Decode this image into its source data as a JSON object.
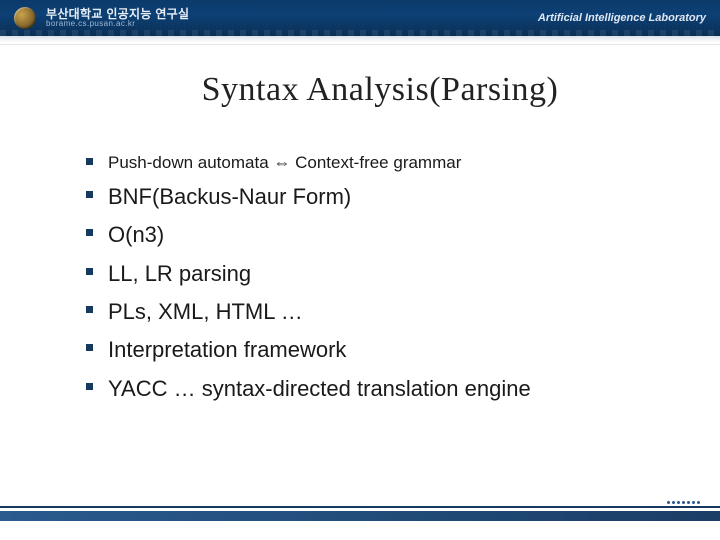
{
  "header": {
    "institution_ko": "부산대학교 인공지능 연구실",
    "institution_url": "borame.cs.pusan.ac.kr",
    "lab_name_en": "Artificial Intelligence Laboratory"
  },
  "slide": {
    "title": "Syntax Analysis(Parsing)",
    "bullets": [
      {
        "text": "Push-down automata ⇔ Context-free grammar",
        "size": "small"
      },
      {
        "text": "BNF(Backus-Naur Form)",
        "size": "large"
      },
      {
        "text": "O(n3)",
        "size": "large"
      },
      {
        "text": "LL, LR parsing",
        "size": "large"
      },
      {
        "text": "PLs, XML, HTML …",
        "size": "large"
      },
      {
        "text": "Interpretation framework",
        "size": "large"
      },
      {
        "text": "YACC … syntax-directed translation engine",
        "size": "large"
      }
    ]
  },
  "colors": {
    "brand_dark": "#153a5f"
  }
}
